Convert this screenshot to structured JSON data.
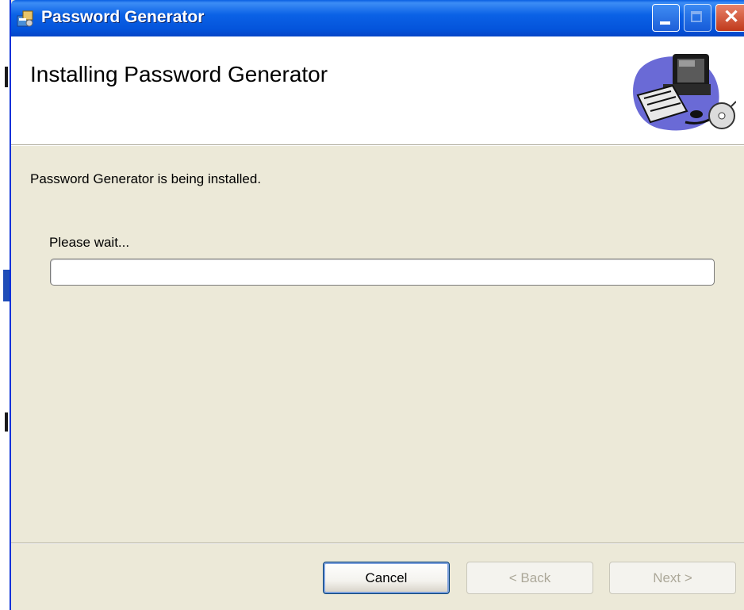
{
  "window": {
    "title": "Password Generator",
    "buttons": {
      "minimize": "minimize",
      "maximize": "maximize",
      "close": "close"
    }
  },
  "banner": {
    "heading": "Installing Password Generator",
    "art_icon": "computer-cd-clipart"
  },
  "body": {
    "status_text": "Password Generator is being installed.",
    "wait_text": "Please wait...",
    "progress_fraction": 0
  },
  "footer": {
    "cancel_label": "Cancel",
    "back_label": "< Back",
    "next_label": "Next >"
  },
  "colors": {
    "titlebar_blue": "#0454db",
    "dialog_bg": "#ece9d8",
    "close_red": "#c0391b"
  }
}
